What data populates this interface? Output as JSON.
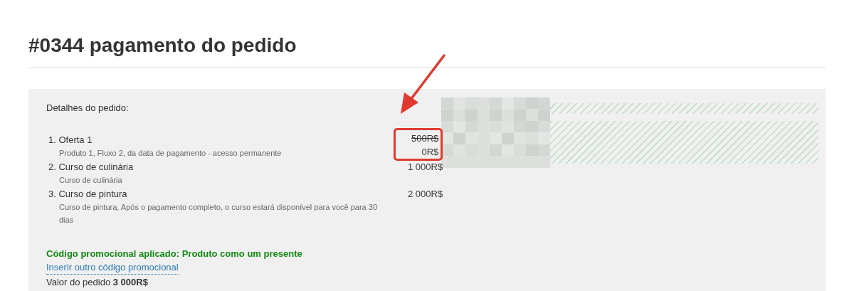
{
  "title": "#0344 pagamento do pedido",
  "details": {
    "heading": "Detalhes do pedido:",
    "items": [
      {
        "number": "1.",
        "name": "Oferta 1",
        "description": "Produto 1, Fluxo 2, da data de pagamento - acesso permanente",
        "old_price": "500R$",
        "price": "0R$",
        "highlighted": true
      },
      {
        "number": "2.",
        "name": "Curso de culinária",
        "description": "Curso de culinária",
        "price": "1 000R$",
        "highlighted": false
      },
      {
        "number": "3.",
        "name": "Curso de pintura",
        "description": "Curso de pintura, Após o pagamento completo, o curso estará disponível para você para 30 dias",
        "price": "2 000R$",
        "highlighted": false
      }
    ],
    "promo_applied": "Código promocional aplicado: Produto como um presente",
    "promo_link": "Inserir outro código promocional",
    "total_label": "Valor do pedido",
    "total_value": "3 000R$"
  }
}
